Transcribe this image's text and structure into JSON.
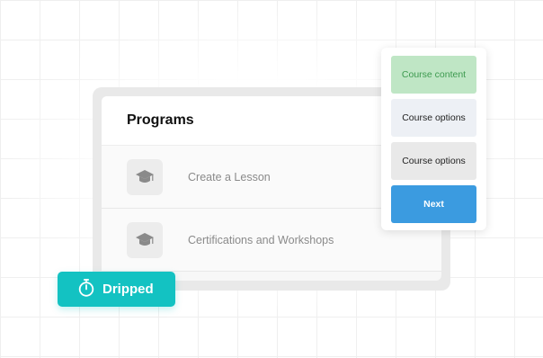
{
  "card": {
    "title": "Programs",
    "rows": [
      {
        "label": "Create a Lesson",
        "icon": "graduation-cap-icon"
      },
      {
        "label": "Certifications and Workshops",
        "icon": "graduation-cap-icon"
      }
    ]
  },
  "menu": {
    "course_content": "Course content",
    "course_options_1": "Course options",
    "course_options_2": "Course options",
    "next": "Next"
  },
  "badge": {
    "label": "Dripped",
    "icon": "stopwatch-icon",
    "color": "#13c2c2"
  },
  "colors": {
    "accent_blue": "#3b9be0",
    "accent_green": "#bfe6c5"
  }
}
